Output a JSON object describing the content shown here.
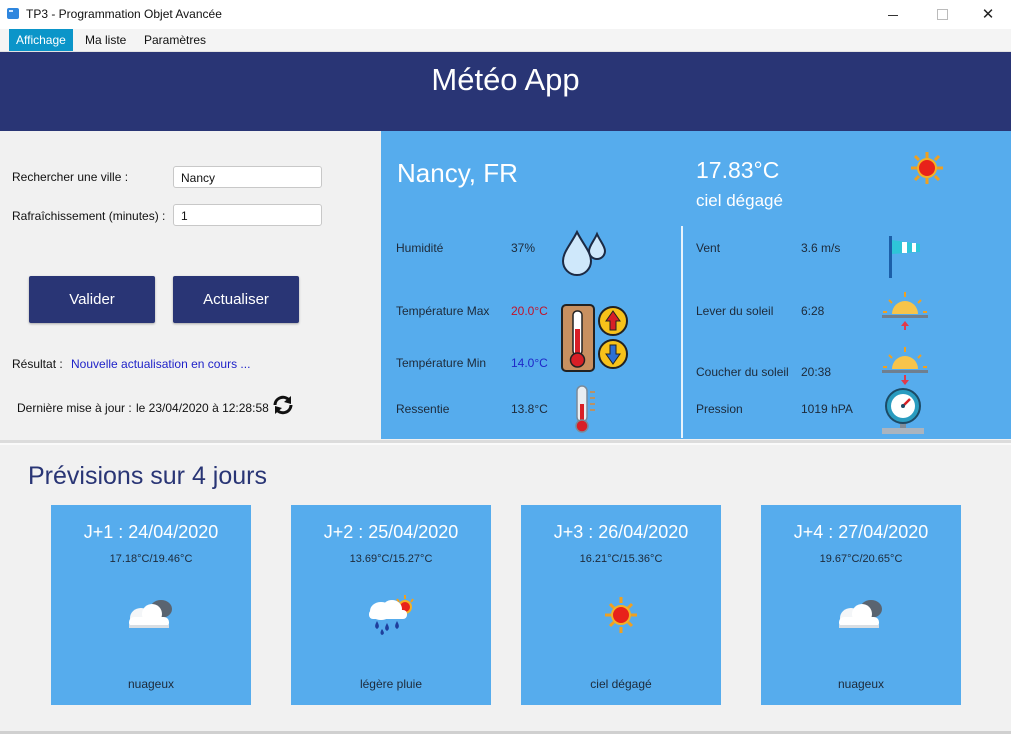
{
  "window": {
    "title": "TP3 - Programmation Objet Avancée",
    "min": "",
    "max": "",
    "close": "✕"
  },
  "menu": [
    "Affichage",
    "Ma liste",
    "Paramètres"
  ],
  "header": {
    "title": "Météo App"
  },
  "form": {
    "search_label": "Rechercher une ville :",
    "search_value": "Nancy",
    "refresh_label": "Rafraîchissement  (minutes) :",
    "refresh_value": "1",
    "validate_button": "Valider",
    "refresh_button": "Actualiser",
    "result_label": "Résultat :",
    "result_text": "Nouvelle actualisation en cours ...",
    "last_update_label": "Dernière mise à jour :",
    "last_update_value": "le 23/04/2020 à 12:28:58"
  },
  "current": {
    "city": "Nancy, FR",
    "temp": "17.83°C",
    "desc": "ciel dégagé",
    "humidity_label": "Humidité",
    "humidity": "37%",
    "tmax_label": "Température Max",
    "tmax": "20.0°C",
    "tmin_label": "Température Min",
    "tmin": "14.0°C",
    "feels_label": "Ressentie",
    "feels": "13.8°C",
    "wind_label": "Vent",
    "wind": "3.6 m/s",
    "sunrise_label": "Lever du soleil",
    "sunrise": "6:28",
    "sunset_label": "Coucher du soleil",
    "sunset": "20:38",
    "pressure_label": "Pression",
    "pressure": "1019 hPA"
  },
  "forecast": {
    "title": "Prévisions sur 4 jours",
    "days": [
      {
        "date": "J+1 : 24/04/2020",
        "range": "17.18°C/19.46°C",
        "desc": "nuageux",
        "icon": "cloud-icon"
      },
      {
        "date": "J+2 : 25/04/2020",
        "range": "13.69°C/15.27°C",
        "desc": "légère pluie",
        "icon": "rain-icon"
      },
      {
        "date": "J+3 : 26/04/2020",
        "range": "16.21°C/15.36°C",
        "desc": "ciel dégagé",
        "icon": "sun-icon"
      },
      {
        "date": "J+4 : 27/04/2020",
        "range": "19.67°C/20.65°C",
        "desc": "nuageux",
        "icon": "cloud-icon"
      }
    ]
  },
  "colors": {
    "header": "#293575",
    "panel": "#56aced",
    "menu_active": "#0b95c9",
    "result": "#1f22c8"
  }
}
